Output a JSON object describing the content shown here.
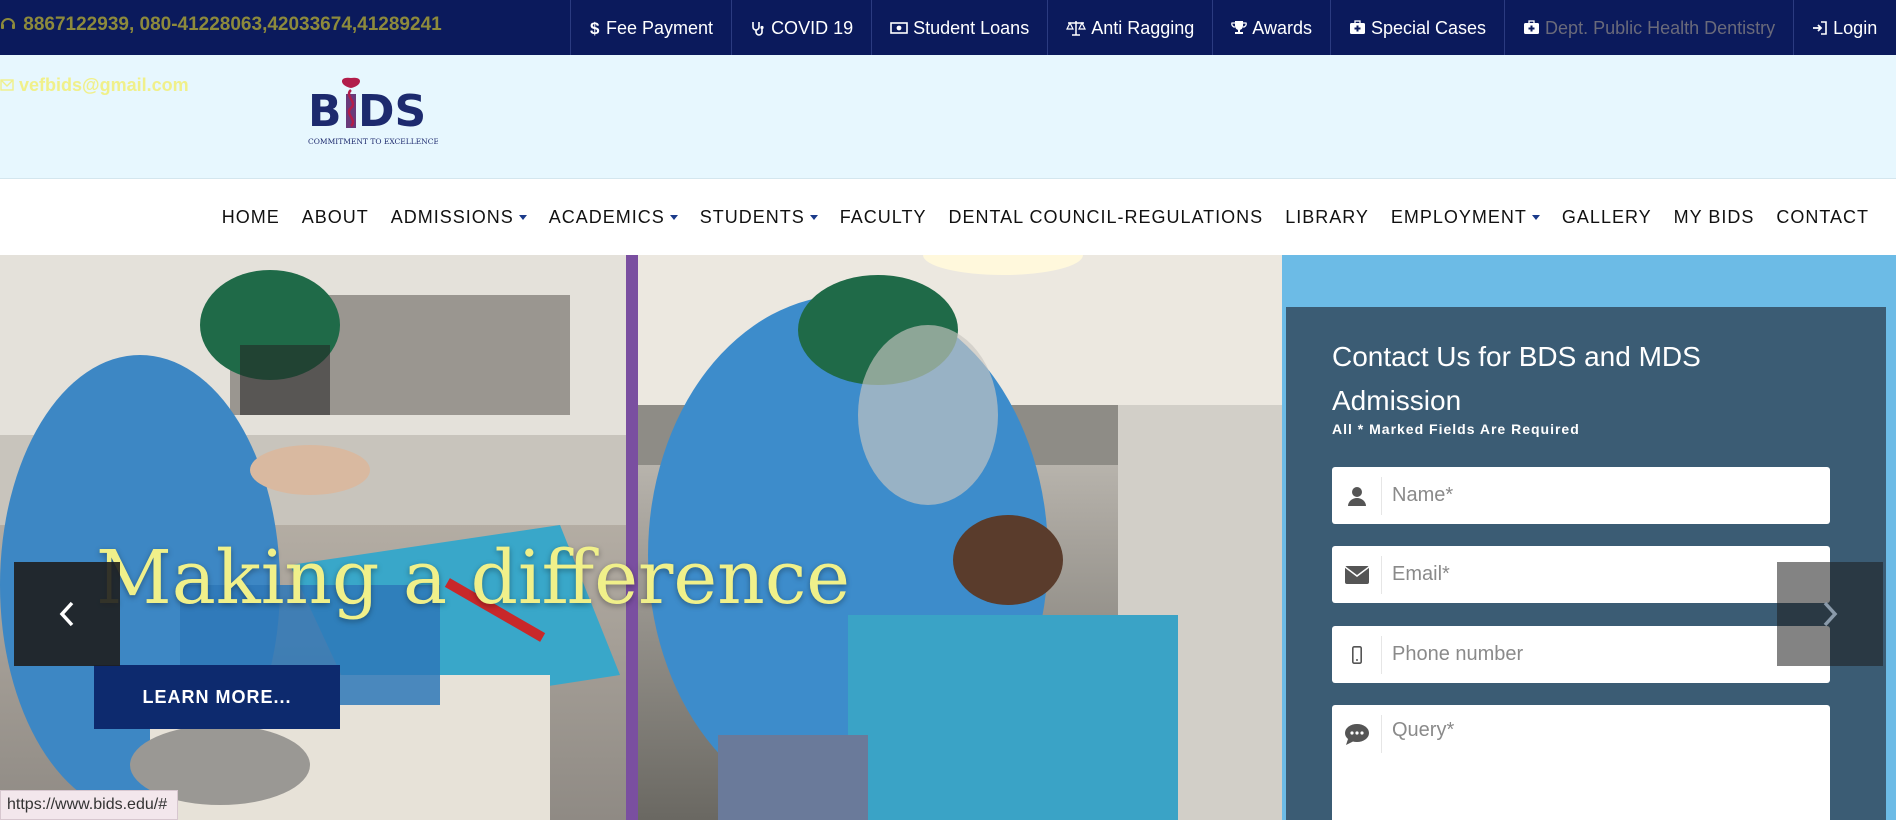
{
  "topbar": {
    "phone": "8867122939, 080-41228063,42033674,41289241",
    "links": [
      {
        "label": "Fee Payment",
        "icon": "dollar-icon"
      },
      {
        "label": "COVID 19",
        "icon": "stethoscope-icon"
      },
      {
        "label": "Student Loans",
        "icon": "money-icon"
      },
      {
        "label": "Anti Ragging",
        "icon": "balance-scale-icon"
      },
      {
        "label": "Awards",
        "icon": "trophy-icon"
      },
      {
        "label": "Special Cases",
        "icon": "medkit-icon"
      },
      {
        "label": "Dept. Public Health Dentistry",
        "icon": "medkit-icon"
      },
      {
        "label": "Login",
        "icon": "sign-in-icon"
      }
    ]
  },
  "header": {
    "email": "vefbids@gmail.com",
    "logo_text": "BIDS",
    "logo_tagline": "COMMITMENT TO EXCELLENCE"
  },
  "nav": {
    "items": [
      {
        "label": "HOME"
      },
      {
        "label": "ABOUT"
      },
      {
        "label": "ADMISSIONS"
      },
      {
        "label": "ACADEMICS"
      },
      {
        "label": "STUDENTS"
      },
      {
        "label": "FACULTY"
      },
      {
        "label": "DENTAL COUNCIL-REGULATIONS"
      },
      {
        "label": "LIBRARY"
      },
      {
        "label": "EMPLOYMENT"
      },
      {
        "label": "GALLERY"
      },
      {
        "label": "MY BIDS"
      },
      {
        "label": "CONTACT"
      }
    ]
  },
  "hero": {
    "title": "Making a difference",
    "button": "LEARN MORE..."
  },
  "contact": {
    "title": "Contact Us for BDS and MDS Admission",
    "required_note": "All * Marked Fields Are Required",
    "fields": {
      "name": "Name*",
      "email": "Email*",
      "phone": "Phone number",
      "query": "Query*"
    }
  },
  "status": {
    "url": "https://www.bids.edu/#"
  },
  "colors": {
    "topbar": "#0b1a5c",
    "header_bg": "#e7f7fe",
    "accent_yellow": "#f0f08a",
    "contact_panel": "#3b5c74",
    "button_navy": "#0d2a6e"
  }
}
